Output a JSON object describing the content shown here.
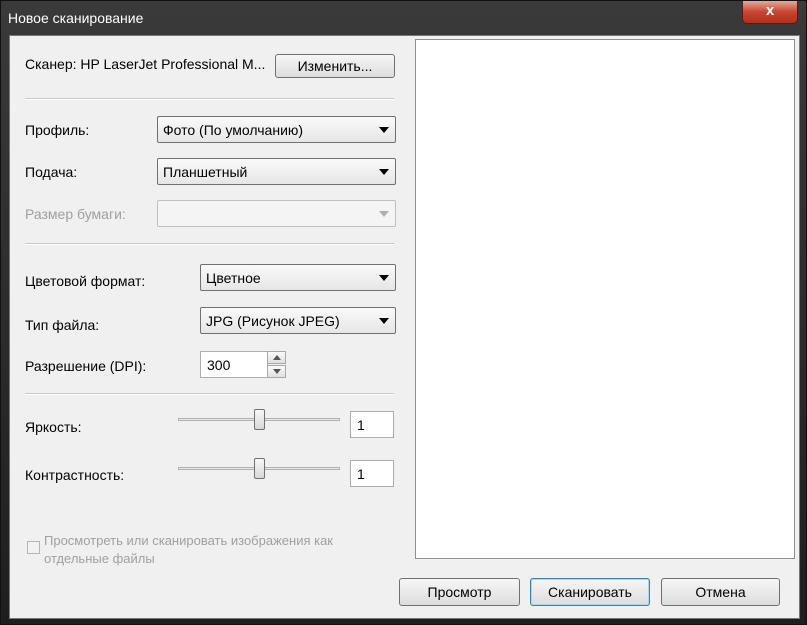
{
  "window": {
    "title": "Новое сканирование",
    "close_glyph": "x"
  },
  "scanner": {
    "label": "Сканер: HP LaserJet Professional M...",
    "change_button": "Изменить..."
  },
  "profile": {
    "label": "Профиль:",
    "value": "Фото (По умолчанию)"
  },
  "feed": {
    "label": "Подача:",
    "value": "Планшетный"
  },
  "paper_size": {
    "label": "Размер бумаги:",
    "value": ""
  },
  "color_format": {
    "label": "Цветовой формат:",
    "value": "Цветное"
  },
  "file_type": {
    "label": "Тип файла:",
    "value": "JPG (Рисунок JPEG)"
  },
  "resolution": {
    "label": "Разрешение (DPI):",
    "value": "300"
  },
  "brightness": {
    "label": "Яркость:",
    "value": "1"
  },
  "contrast": {
    "label": "Контрастность:",
    "value": "1"
  },
  "separate_files": {
    "label_line1": "Просмотреть или сканировать изображения как",
    "label_line2": "отдельные файлы",
    "checked": false
  },
  "buttons": {
    "preview": "Просмотр",
    "scan": "Сканировать",
    "cancel": "Отмена"
  }
}
